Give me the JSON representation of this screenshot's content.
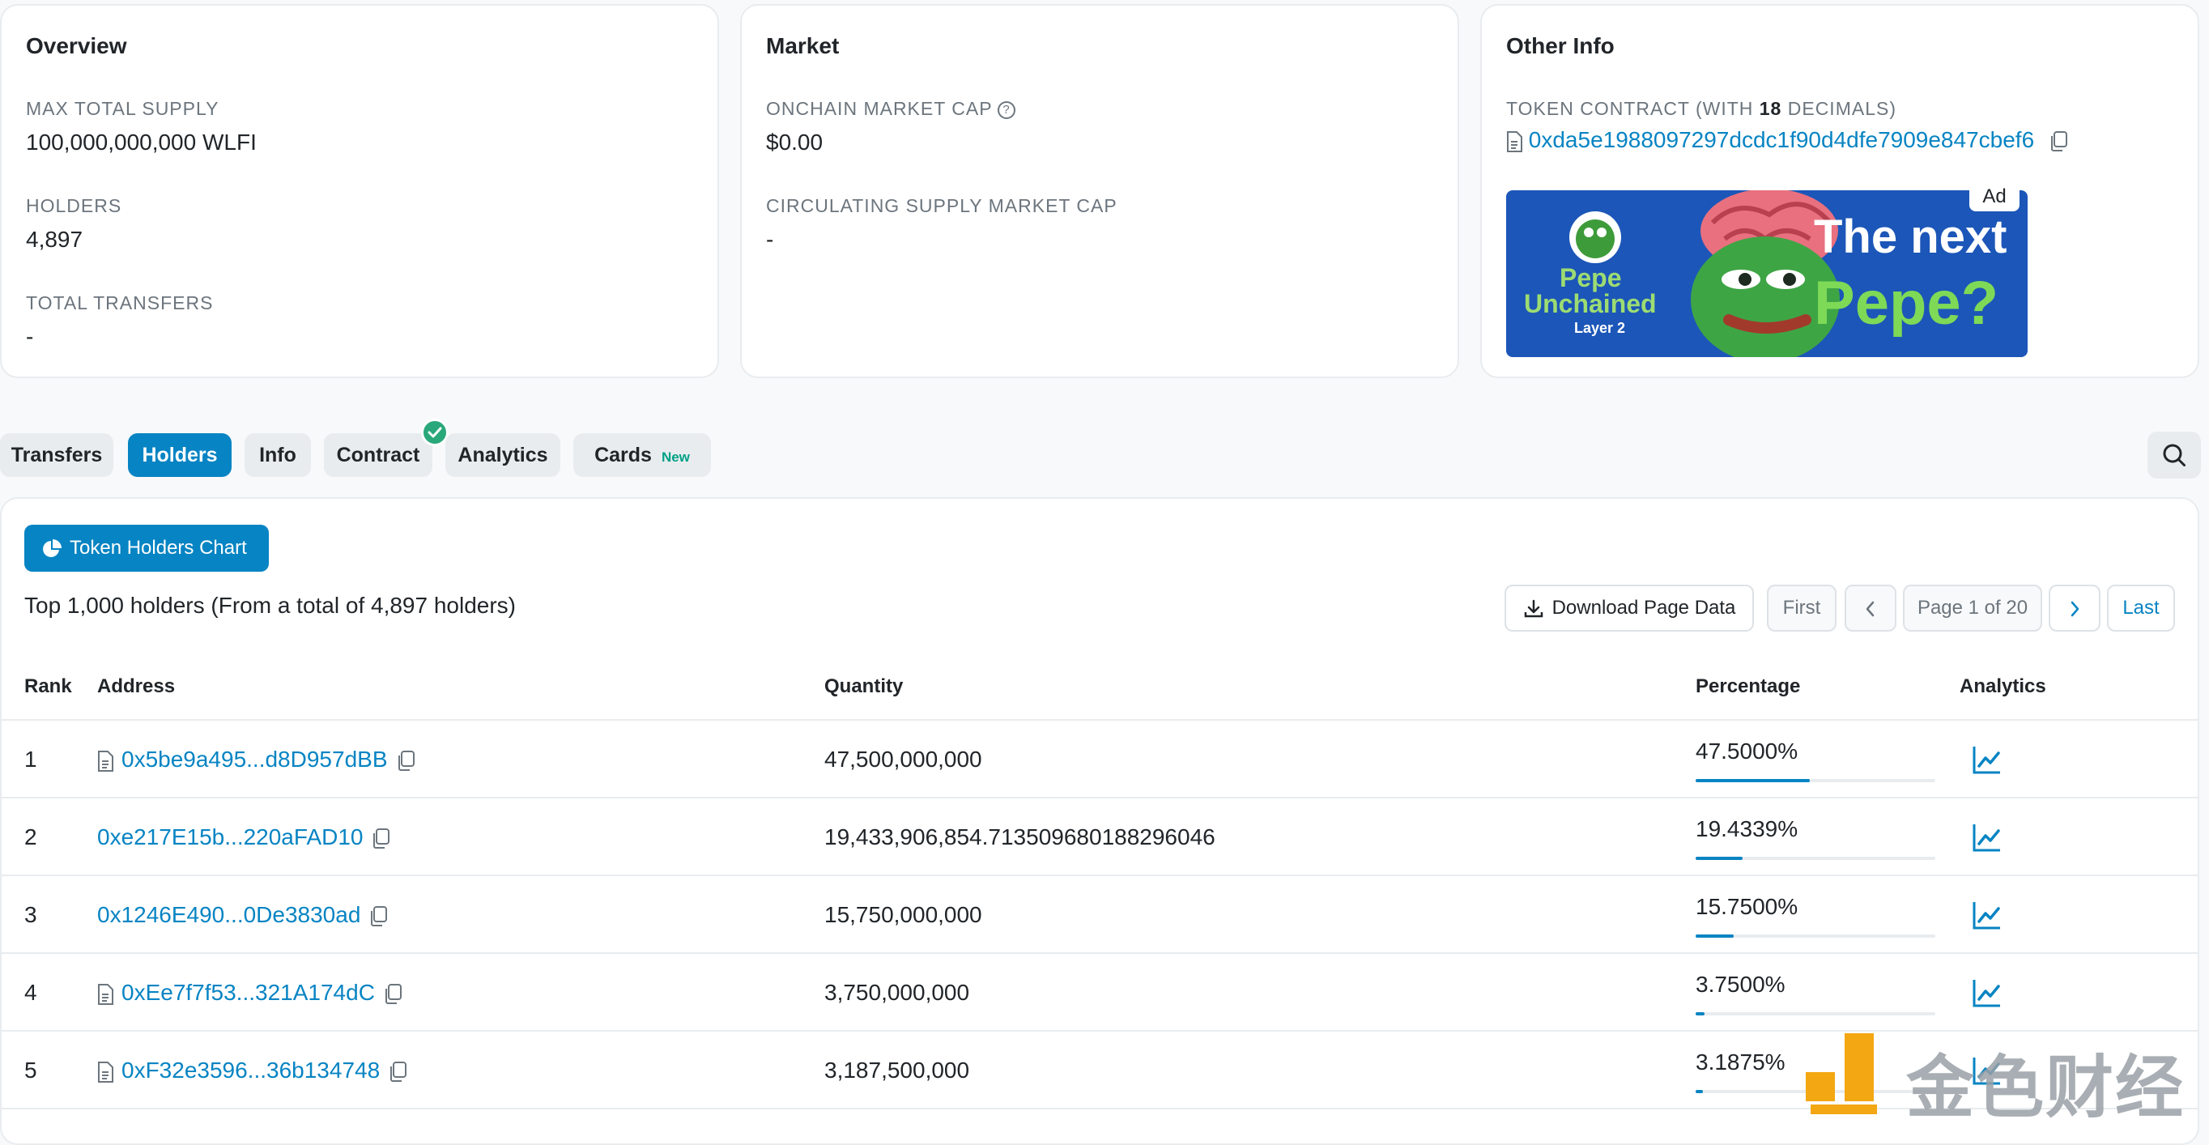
{
  "overview": {
    "title": "Overview",
    "max_supply_label": "MAX TOTAL SUPPLY",
    "max_supply_value": "100,000,000,000 WLFI",
    "holders_label": "HOLDERS",
    "holders_value": "4,897",
    "transfers_label": "TOTAL TRANSFERS",
    "transfers_value": "-"
  },
  "market": {
    "title": "Market",
    "onchain_cap_label": "ONCHAIN MARKET CAP",
    "onchain_cap_value": "$0.00",
    "circ_cap_label": "CIRCULATING SUPPLY MARKET CAP",
    "circ_cap_value": "-"
  },
  "other_info": {
    "title": "Other Info",
    "contract_label_prefix": "TOKEN CONTRACT (WITH ",
    "contract_decimals": "18",
    "contract_label_suffix": " DECIMALS)",
    "contract_address": "0xda5e1988097297dcdc1f90d4dfe7909e847cbef6",
    "ad_badge": "Ad",
    "ad_brand_line1": "Pepe",
    "ad_brand_line2": "Unchained",
    "ad_brand_line3": "Layer 2",
    "ad_headline_1": "The next",
    "ad_headline_2": "Pepe?"
  },
  "tabs": [
    {
      "label": "Transfers"
    },
    {
      "label": "Holders"
    },
    {
      "label": "Info"
    },
    {
      "label": "Contract"
    },
    {
      "label": "Analytics"
    },
    {
      "label": "Cards",
      "badge": "New"
    }
  ],
  "holders": {
    "chart_button": "Token Holders Chart",
    "summary": "Top 1,000 holders (From a total of 4,897 holders)",
    "download": "Download Page Data",
    "first": "First",
    "page_info": "Page 1 of 20",
    "last": "Last",
    "columns": {
      "rank": "Rank",
      "address": "Address",
      "quantity": "Quantity",
      "percentage": "Percentage",
      "analytics": "Analytics"
    },
    "rows": [
      {
        "rank": "1",
        "address": "0x5be9a495...d8D957dBB",
        "contract": true,
        "quantity": "47,500,000,000",
        "percentage": "47.5000%",
        "pct": 47.5
      },
      {
        "rank": "2",
        "address": "0xe217E15b...220aFAD10",
        "contract": false,
        "quantity": "19,433,906,854.713509680188296046",
        "percentage": "19.4339%",
        "pct": 19.4339
      },
      {
        "rank": "3",
        "address": "0x1246E490...0De3830ad",
        "contract": false,
        "quantity": "15,750,000,000",
        "percentage": "15.7500%",
        "pct": 15.75
      },
      {
        "rank": "4",
        "address": "0xEe7f7f53...321A174dC",
        "contract": true,
        "quantity": "3,750,000,000",
        "percentage": "3.7500%",
        "pct": 3.75
      },
      {
        "rank": "5",
        "address": "0xF32e3596...36b134748",
        "contract": true,
        "quantity": "3,187,500,000",
        "percentage": "3.1875%",
        "pct": 3.1875
      }
    ]
  },
  "watermark": "金色财经",
  "colors": {
    "accent": "#0784c3",
    "verified": "#2aa87a",
    "new_badge": "#00a186"
  }
}
